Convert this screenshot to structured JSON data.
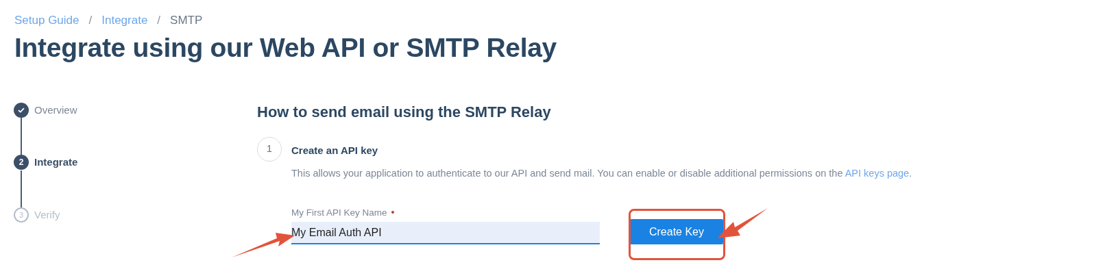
{
  "breadcrumb": [
    {
      "label": "Setup Guide",
      "kind": "link"
    },
    {
      "label": "Integrate",
      "kind": "link"
    },
    {
      "label": "SMTP",
      "kind": "current"
    }
  ],
  "breadcrumb_separator": "/",
  "title": "Integrate using our Web API or SMTP Relay",
  "steps": [
    {
      "label": "Overview",
      "kind": "done"
    },
    {
      "label": "Integrate",
      "number": "2",
      "kind": "current"
    },
    {
      "label": "Verify",
      "number": "3",
      "kind": "pending"
    }
  ],
  "section": {
    "heading": "How to send email using the SMTP Relay",
    "step_number": "1",
    "step_title": "Create an API key",
    "description": "This allows your application to authenticate to our API and send mail. You can enable or disable additional permissions on the ",
    "link": "API keys page",
    "description_end": ".",
    "field": {
      "label": "My First API Key Name",
      "required": true,
      "value": "My Email Auth API",
      "focused": true
    },
    "button": "Create Key"
  }
}
